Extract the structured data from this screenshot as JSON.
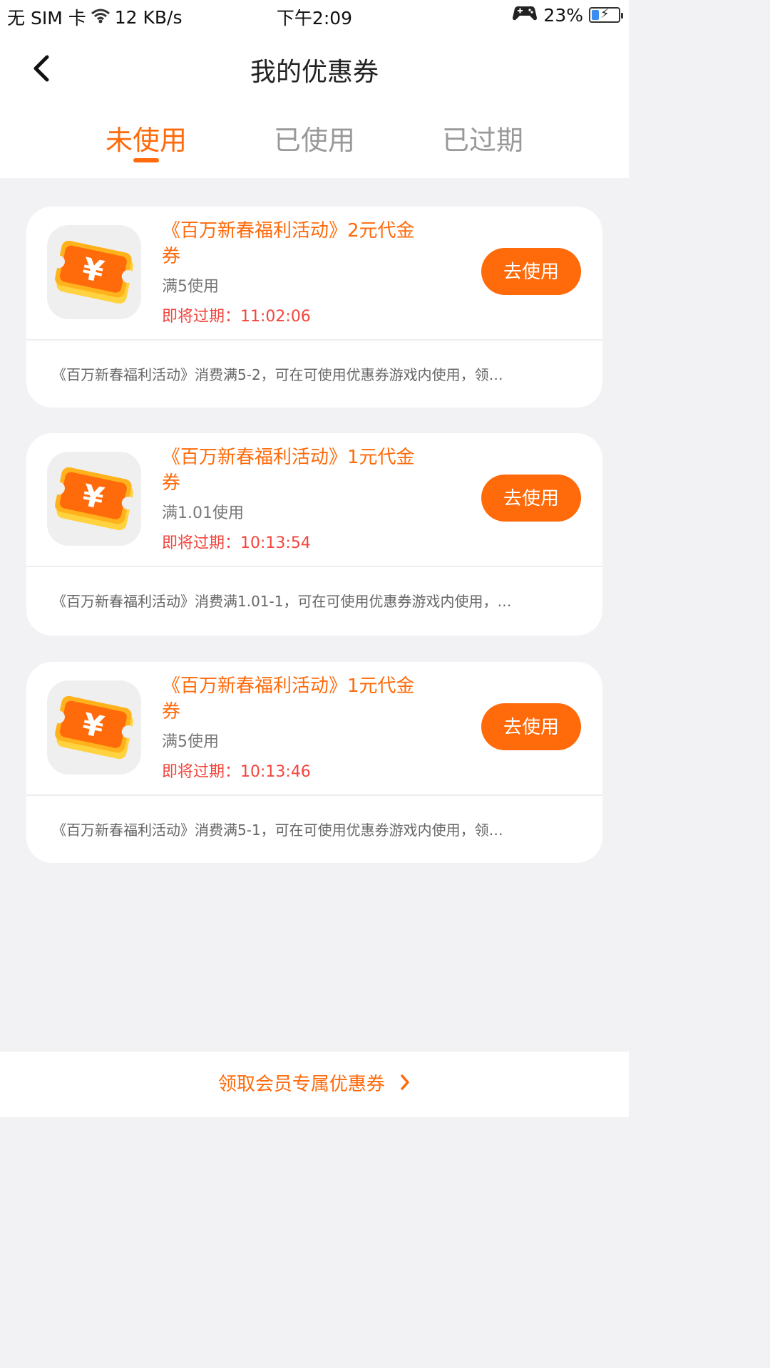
{
  "status_bar": {
    "carrier": "无 SIM 卡",
    "net_speed": "12 KB/s",
    "time": "下午2:09",
    "battery": "23%"
  },
  "header": {
    "title": "我的优惠券"
  },
  "tabs": [
    {
      "label": "未使用",
      "active": true
    },
    {
      "label": "已使用",
      "active": false
    },
    {
      "label": "已过期",
      "active": false
    }
  ],
  "coupons": [
    {
      "name": "《百万新春福利活动》2元代金券",
      "condition": "满5使用",
      "expire": "即将过期：11:02:06",
      "button": "去使用",
      "desc": "《百万新春福利活动》消费满5-2，可在可使用优惠券游戏内使用，领…"
    },
    {
      "name": "《百万新春福利活动》1元代金券",
      "condition": "满1.01使用",
      "expire": "即将过期：10:13:54",
      "button": "去使用",
      "desc": "《百万新春福利活动》消费满1.01-1，可在可使用优惠券游戏内使用，…"
    },
    {
      "name": "《百万新春福利活动》1元代金券",
      "condition": "满5使用",
      "expire": "即将过期：10:13:46",
      "button": "去使用",
      "desc": "《百万新春福利活动》消费满5-1，可在可使用优惠券游戏内使用，领…"
    }
  ],
  "footer": {
    "link": "领取会员专属优惠券"
  },
  "colors": {
    "accent": "#ff6a0a",
    "expire": "#f2453d",
    "background": "#f2f2f4"
  }
}
